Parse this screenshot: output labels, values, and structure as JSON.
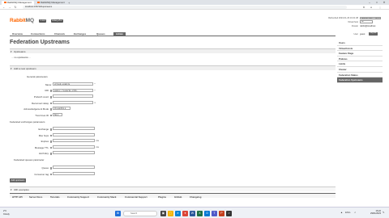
{
  "browser": {
    "tabs": [
      {
        "title": "RabbitMQ Management"
      },
      {
        "title": "RabbitMQ Management"
      }
    ],
    "new_tab": "+",
    "url": "localhost:15672/#/upstreams",
    "window_controls": [
      "–",
      "□",
      "✕"
    ]
  },
  "header": {
    "logo_main": "Rabbit",
    "logo_mq": "MQ",
    "version": "3.11.6",
    "erlang": "Erlang 25.2",
    "refreshed": "Refreshed 2023-01-29 16:21:38",
    "refresh_select": "Refresh every 5 seconds",
    "virtual_host_label": "Virtual host",
    "virtual_host_value": "All",
    "cluster_label": "Cluster",
    "cluster_value": "rabbit@localhost",
    "user_label": "User",
    "user_value": "guest",
    "logout_label": "Log out"
  },
  "menu": {
    "items": [
      {
        "label": "Overview"
      },
      {
        "label": "Connections"
      },
      {
        "label": "Channels"
      },
      {
        "label": "Exchanges"
      },
      {
        "label": "Queues"
      },
      {
        "label": "Admin"
      }
    ]
  },
  "page": {
    "title": "Federation Upstreams",
    "upstreams_section": "Upstreams",
    "filter_text": "... no upstreams ...",
    "add_section": "Add a new upstream",
    "general_title": "General parameters",
    "fields": {
      "name": {
        "label": "Name:",
        "value": "eCloud-example",
        "req": "*"
      },
      "uri": {
        "label": "URI:",
        "value": "amqps://sugardo.ct91…",
        "req": "*"
      },
      "prefetch": {
        "label": "Prefetch count:",
        "value": ""
      },
      "reconnect": {
        "label": "Reconnect delay:",
        "value": "",
        "unit": "s"
      },
      "ack_mode": {
        "label": "Acknowledgement Mode:",
        "value": "On confirm"
      },
      "trust_user": {
        "label": "Trust User-ID:",
        "value": "No"
      }
    },
    "exchange_title": "Federated exchanges parameters",
    "exchange_fields": {
      "exchange": {
        "label": "Exchange:",
        "value": ""
      },
      "max_hops": {
        "label": "Max hops:",
        "value": ""
      },
      "expires": {
        "label": "Expires:",
        "value": "",
        "unit": "ms"
      },
      "message_ttl": {
        "label": "Message TTL:",
        "value": "",
        "unit": "ms"
      },
      "ha_policy": {
        "label": "HA Policy:",
        "value": ""
      }
    },
    "queue_title": "Federated queues parameter",
    "queue_fields": {
      "queue": {
        "label": "Queue:",
        "value": ""
      },
      "consumer_tag": {
        "label": "Consumer tag:",
        "value": ""
      }
    },
    "add_button": "Add upstream",
    "uri_examples": "URI examples"
  },
  "sidebar": {
    "items": [
      {
        "label": "Users"
      },
      {
        "label": "Virtual Hosts"
      },
      {
        "label": "Feature Flags"
      },
      {
        "label": "Policies"
      },
      {
        "label": "Limits"
      },
      {
        "label": "Cluster"
      },
      {
        "label": "Federation Status"
      },
      {
        "label": "Federation Upstreams"
      }
    ]
  },
  "footer": {
    "links": [
      {
        "label": "HTTP API"
      },
      {
        "label": "Server Docs"
      },
      {
        "label": "Tutorials"
      },
      {
        "label": "Community Support"
      },
      {
        "label": "Community Slack"
      },
      {
        "label": "Commercial Support"
      },
      {
        "label": "Plugins"
      },
      {
        "label": "GitHub"
      },
      {
        "label": "Changelog"
      }
    ]
  },
  "taskbar": {
    "weather_temp": "2°C",
    "weather_desc": "Cloudy",
    "search_placeholder": "Search",
    "time": "16:22",
    "date": "29/01/2023",
    "lang": "ENG"
  },
  "colors": {
    "accent": "#ff6600",
    "menu_active": "#666666"
  }
}
